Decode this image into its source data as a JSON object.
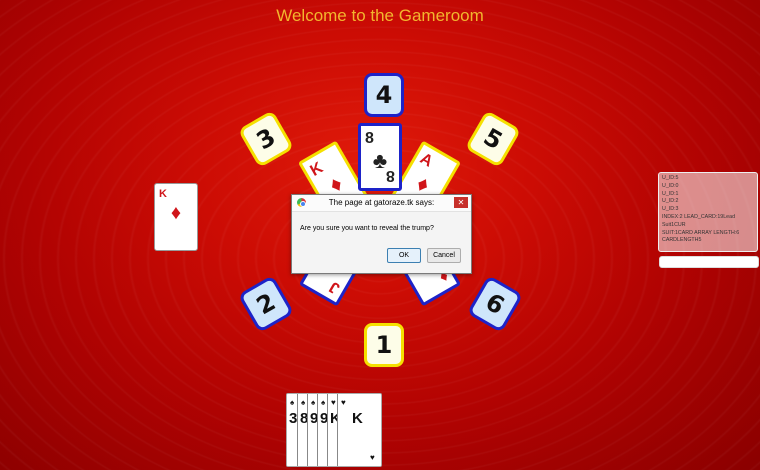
{
  "title": "Welcome to the Gameroom",
  "seats": [
    {
      "number": "1",
      "style": "yellow"
    },
    {
      "number": "2",
      "style": "blue"
    },
    {
      "number": "3",
      "style": "yellow"
    },
    {
      "number": "4",
      "style": "blue"
    },
    {
      "number": "5",
      "style": "yellow"
    },
    {
      "number": "6",
      "style": "blue"
    }
  ],
  "trick": [
    {
      "rank": "K",
      "suit": "♦",
      "color": "red"
    },
    {
      "rank": "8",
      "suit": "♣",
      "color": "black"
    },
    {
      "rank": "A",
      "suit": "♦",
      "color": "red"
    },
    {
      "rank": "J",
      "suit": "♦",
      "color": "red"
    },
    {
      "rank": "",
      "suit": "♦",
      "color": "red"
    }
  ],
  "left_card": {
    "rank": "K",
    "suit": "♦"
  },
  "dialog": {
    "title": "The page at gatoraze.tk says:",
    "message": "Are you sure you want to reveal the trump?",
    "ok_label": "OK",
    "cancel_label": "Cancel",
    "close_label": "✕"
  },
  "log": {
    "lines": [
      "U_ID:5",
      "U_ID:0",
      "U_ID:1",
      "U_ID:2",
      "U_ID:3",
      "INDEX:2 LEAD_CARD:19Lead Suit1CUR",
      "SUIT:1CARD ARRAY LENGTH:6",
      "CARDLENGTH5"
    ]
  },
  "hand": [
    {
      "rank": "3",
      "suit": "♠"
    },
    {
      "rank": "8",
      "suit": "♠"
    },
    {
      "rank": "9",
      "suit": "♠"
    },
    {
      "rank": "9",
      "suit": "♠"
    },
    {
      "rank": "K",
      "suit": "♥"
    },
    {
      "rank": "K",
      "suit": "♥"
    }
  ]
}
